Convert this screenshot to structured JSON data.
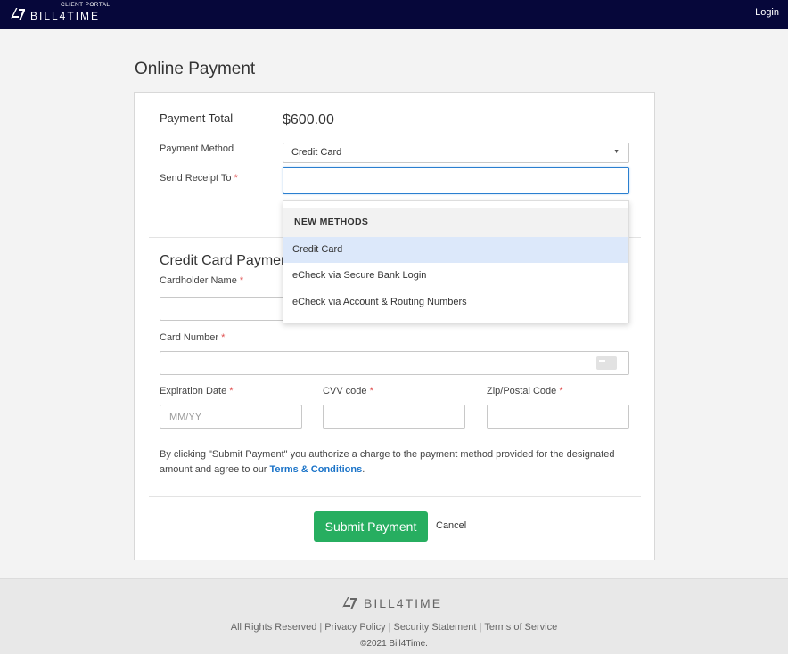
{
  "header": {
    "portal_label": "CLIENT PORTAL",
    "brand": "BILL4TIME",
    "login_label": "Login"
  },
  "page": {
    "title": "Online Payment"
  },
  "payment": {
    "total_label": "Payment Total",
    "total_value": "$600.00",
    "method_label": "Payment Method",
    "method_value": "Credit Card",
    "receipt_label": "Send Receipt To",
    "receipt_value": ""
  },
  "credit_card": {
    "section_title": "Credit Card Payment",
    "cardholder_label": "Cardholder Name",
    "card_number_label": "Card Number",
    "expiration_label": "Expiration Date",
    "expiration_placeholder": "MM/YY",
    "cvv_label": "CVV code",
    "zip_label": "Zip/Postal Code"
  },
  "required_mark": "*",
  "disclaimer": {
    "text": "By clicking \"Submit Payment\" you authorize a charge to the payment method provided for the designated amount and agree to our ",
    "terms_link": "Terms & Conditions",
    "end": "."
  },
  "actions": {
    "submit_label": "Submit Payment",
    "cancel_label": "Cancel"
  },
  "dropdown": {
    "group_header": "NEW METHODS",
    "options": [
      "Credit Card",
      "eCheck via Secure Bank Login",
      "eCheck via Account & Routing Numbers"
    ],
    "selected_index": 0
  },
  "footer": {
    "brand": "BILL4TIME",
    "links": [
      "All Rights Reserved",
      "Privacy Policy",
      "Security Statement",
      "Terms of Service"
    ],
    "separator": "|",
    "copyright": "©2021 Bill4Time."
  },
  "colors": {
    "navbar": "#06073a",
    "submit": "#27ae60",
    "link": "#1a73c8",
    "focus": "#2a7fd0",
    "selected_option": "#dce8fa"
  },
  "icons": {
    "logo": "bill4time-logo-icon",
    "caret": "chevron-down-icon",
    "card": "credit-card-icon"
  }
}
